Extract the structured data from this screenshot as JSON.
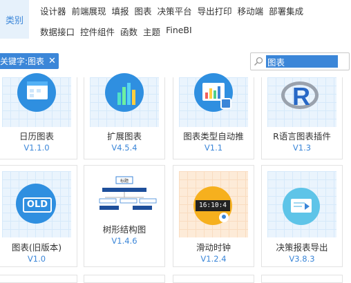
{
  "category": {
    "label": "类别"
  },
  "nav": {
    "row1": [
      "设计器",
      "前端展现",
      "填报",
      "图表",
      "决策平台",
      "导出打印",
      "移动端",
      "部署集成"
    ],
    "row2": [
      "数据接口",
      "控件组件",
      "函数",
      "主题",
      "FineBI"
    ]
  },
  "filter": {
    "tag_label": "关键字:图表",
    "close_glyph": "✕"
  },
  "search": {
    "value": "图表"
  },
  "cards": [
    {
      "name": "日历图表",
      "version": "V1.1.0"
    },
    {
      "name": "扩展图表",
      "version": "V4.5.4"
    },
    {
      "name": "图表类型自动推",
      "version": "V1.1"
    },
    {
      "name": "R语言图表插件",
      "version": "V1.3"
    },
    {
      "name": "图表(旧版本)",
      "version": "V1.0"
    },
    {
      "name": "树形结构图",
      "version": "V1.4.6"
    },
    {
      "name": "滑动时钟",
      "version": "V1.2.4"
    },
    {
      "name": "决策报表导出",
      "version": "V3.8.3"
    }
  ],
  "thumb_text": {
    "old": "OLD",
    "clock": "16:10:4",
    "r_letter": "R",
    "tree_title": "标题"
  },
  "colors": {
    "accent": "#3b86d8",
    "thumb_bg": "#eaf4fd"
  }
}
